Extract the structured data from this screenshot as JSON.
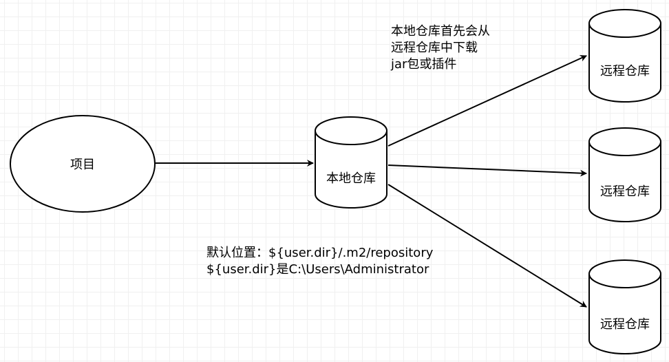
{
  "diagram": {
    "project_label": "项目",
    "local_repo_label": "本地仓库",
    "remote_repo_labels": [
      "远程仓库",
      "远程仓库",
      "远程仓库"
    ],
    "note_top": [
      "本地仓库首先会从",
      "远程仓库中下载",
      "jar包或插件"
    ],
    "note_bottom": [
      "默认位置：${user.dir}/.m2/repository",
      "${user.dir}是C:\\Users\\Administrator"
    ],
    "colors": {
      "stroke": "#000000",
      "fill": "#ffffff",
      "grid": "#f0f0f0"
    }
  }
}
